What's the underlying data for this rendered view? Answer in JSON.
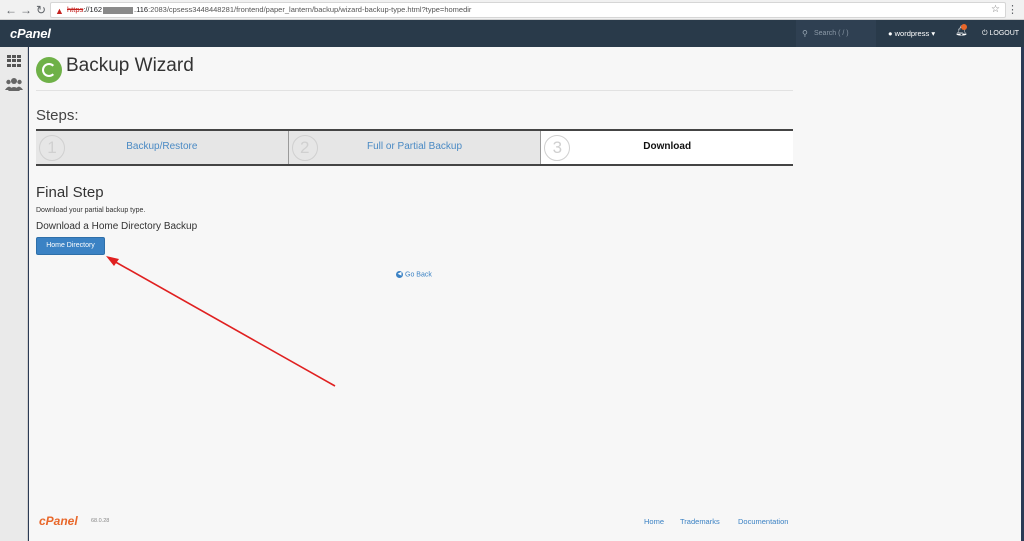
{
  "browser": {
    "url_scheme": "https",
    "url_host": "://162",
    "url_host_tail": ".116",
    "url_path": ":2083/cpsess3448448281/frontend/paper_lantern/backup/wizard-backup-type.html?type=homedir"
  },
  "topbar": {
    "logo": "cPanel",
    "search_placeholder": "Search ( / )",
    "username": "wordpress",
    "logout": "LOGOUT"
  },
  "page": {
    "title": "Backup Wizard",
    "steps_heading": "Steps:",
    "steps": [
      {
        "number": "1",
        "label": "Backup/Restore"
      },
      {
        "number": "2",
        "label": "Full or Partial Backup"
      },
      {
        "number": "3",
        "label": "Download"
      }
    ],
    "final_heading": "Final Step",
    "final_desc": "Download your partial backup type.",
    "download_heading": "Download a Home Directory Backup",
    "home_dir_button": "Home Directory",
    "go_back": "Go Back"
  },
  "footer": {
    "logo": "cPanel",
    "version": "68.0.28",
    "links": [
      "Home",
      "Trademarks",
      "Documentation"
    ]
  },
  "colors": {
    "accent": "#3b82c4",
    "topbar": "#293a4a",
    "annotation_arrow": "#e02020"
  }
}
